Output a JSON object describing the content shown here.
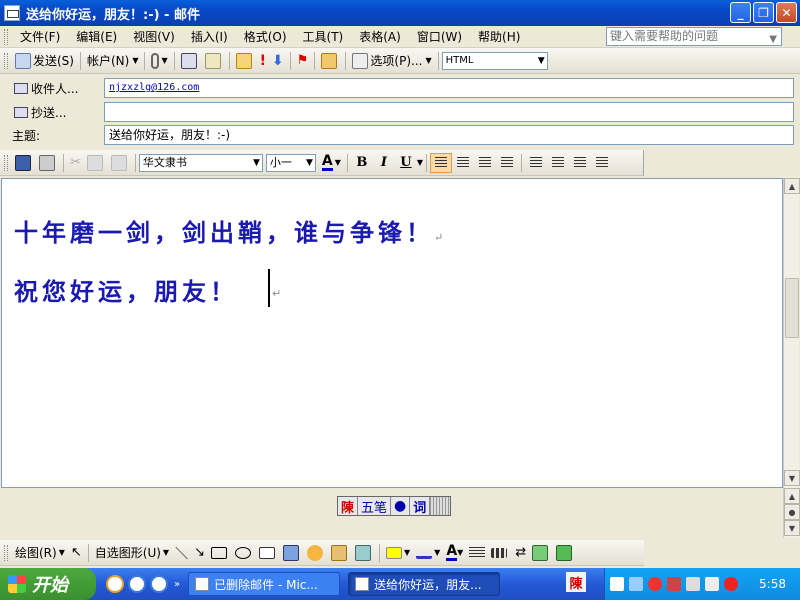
{
  "window": {
    "title": "送给你好运，朋友！:-) - 邮件"
  },
  "menu": {
    "items": [
      "文件(F)",
      "编辑(E)",
      "视图(V)",
      "插入(I)",
      "格式(O)",
      "工具(T)",
      "表格(A)",
      "窗口(W)",
      "帮助(H)"
    ],
    "help_placeholder": "键入需要帮助的问题"
  },
  "toolbar": {
    "send": "发送(S)",
    "account": "帐户(N)",
    "options": "选项(P)...",
    "format": "HTML"
  },
  "fields": {
    "to_label": "收件人...",
    "to_value": "njzxzlg@126.com",
    "cc_label": "抄送...",
    "cc_value": "",
    "subject_label": "主题:",
    "subject_value": "送给你好运，朋友！:-)"
  },
  "format_bar": {
    "font": "华文隶书",
    "size": "小一",
    "bold": "B",
    "italic": "I",
    "underline": "U"
  },
  "body": {
    "line1": "十年磨一剑，剑出鞘，谁与争锋！",
    "line2": "祝您好运，朋友！",
    "para_mark": "↵"
  },
  "ime": {
    "chen": "陳",
    "wubi": "五笔",
    "dot": "●",
    "ci": "词"
  },
  "draw_bar": {
    "draw": "绘图(R)",
    "autoshapes": "自选图形(U)"
  },
  "taskbar": {
    "start": "开始",
    "task1": "已删除邮件 - Mic...",
    "task2": "送给你好运，朋友...",
    "tray_ime": "陳",
    "clock": "5:58"
  }
}
